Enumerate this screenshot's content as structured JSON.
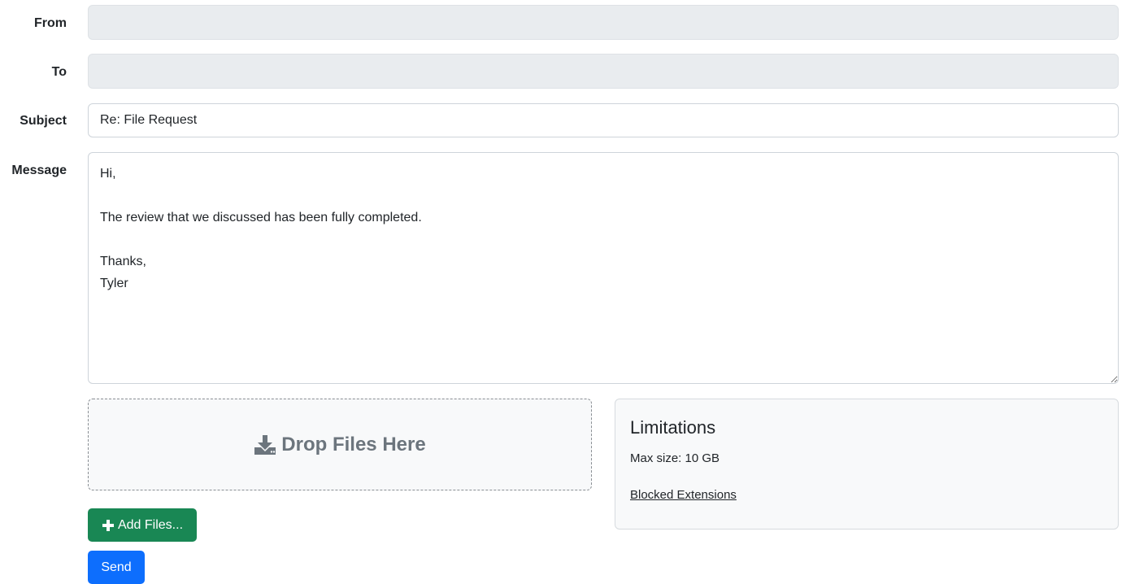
{
  "form": {
    "from": {
      "label": "From",
      "value": ""
    },
    "to": {
      "label": "To",
      "value": ""
    },
    "subject": {
      "label": "Subject",
      "value": "Re: File Request"
    },
    "message": {
      "label": "Message",
      "value": "Hi,\n\nThe review that we discussed has been fully completed.\n\nThanks,\nTyler"
    }
  },
  "dropzone": {
    "icon": "download-icon",
    "label": "Drop Files Here"
  },
  "limitations": {
    "title": "Limitations",
    "max_size": "Max size: 10 GB",
    "blocked_link": "Blocked Extensions"
  },
  "buttons": {
    "add_files": {
      "icon": "plus-icon",
      "label": "Add Files...",
      "color": "#198754"
    },
    "send": {
      "label": "Send",
      "color": "#0d6efd"
    }
  }
}
